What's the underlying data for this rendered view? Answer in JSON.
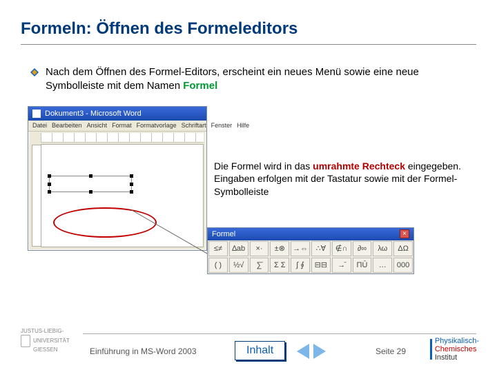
{
  "title": "Formeln: Öffnen des Formeleditors",
  "bullet": {
    "pre": "Nach dem Öffnen des Formel-Editors, erscheint ein neues Menü sowie eine neue Symbolleiste mit dem Namen ",
    "hl": "Formel"
  },
  "word": {
    "title": "Dokument3 - Microsoft Word",
    "menu": [
      "Datei",
      "Bearbeiten",
      "Ansicht",
      "Format",
      "Formatvorlage",
      "Schriftart",
      "Fenster",
      "Hilfe"
    ]
  },
  "callout": {
    "t1": "Die Formel wird in das ",
    "hl": "umrahmte Rechteck",
    "t2": " eingegeben. Eingaben erfolgen mit der Tastatur sowie mit der Formel-Symbolleiste"
  },
  "toolbar": {
    "title": "Formel",
    "row1": [
      "≤≠",
      "∆ab",
      "×·",
      "±⊗",
      "→⇔",
      "∴∀",
      "∉∩",
      "∂∞",
      "λω",
      "ΔΩ"
    ],
    "row2": [
      "( )",
      "½√",
      "∑̄",
      "Σ Σ",
      "∫ ∮",
      "⊟⊟",
      "→̄",
      "ΠŪ",
      "…",
      "000"
    ]
  },
  "footer": {
    "uni1": "JUSTUS-LIEBIG-",
    "uni2": "UNIVERSITÄT",
    "uni3": "GIESSEN",
    "left": "Einführung in MS-Word 2003",
    "inhalt": "Inhalt",
    "page": "Seite 29",
    "inst1": "Physikalisch-",
    "inst2": "Chemisches",
    "inst3": "Institut"
  }
}
